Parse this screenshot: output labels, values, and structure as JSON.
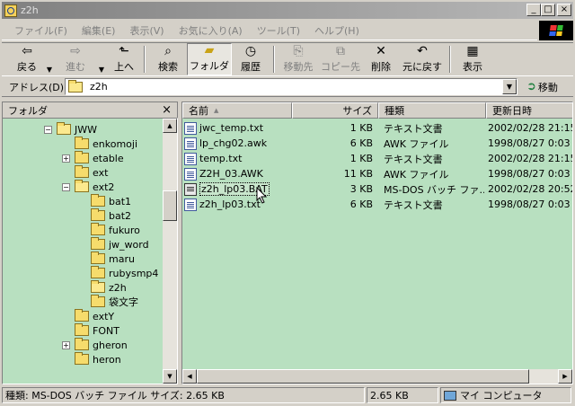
{
  "window": {
    "title": "z2h",
    "minimize": "_",
    "maximize": "□",
    "close": "×"
  },
  "menu": [
    "ファイル(F)",
    "編集(E)",
    "表示(V)",
    "お気に入り(A)",
    "ツール(T)",
    "ヘルプ(H)"
  ],
  "toolbar": {
    "back": "戻る",
    "forward": "進む",
    "up": "上へ",
    "search": "検索",
    "folders": "フォルダ",
    "history": "履歴",
    "moveto": "移動先",
    "copyto": "コピー先",
    "delete": "削除",
    "undo": "元に戻す",
    "views": "表示"
  },
  "address": {
    "label": "アドレス(D)",
    "value": "z2h",
    "go": "移動"
  },
  "folder_pane": {
    "title": "フォルダ",
    "close": "×",
    "items": [
      {
        "label": "JWW",
        "expander": "−"
      },
      {
        "label": "enkomoji",
        "expander": ""
      },
      {
        "label": "etable",
        "expander": "+"
      },
      {
        "label": "ext",
        "expander": ""
      },
      {
        "label": "ext2",
        "expander": "−"
      },
      {
        "label": "bat1",
        "expander": ""
      },
      {
        "label": "bat2",
        "expander": ""
      },
      {
        "label": "fukuro",
        "expander": ""
      },
      {
        "label": "jw_word",
        "expander": ""
      },
      {
        "label": "maru",
        "expander": ""
      },
      {
        "label": "rubysmp4",
        "expander": ""
      },
      {
        "label": "z2h",
        "expander": ""
      },
      {
        "label": "袋文字",
        "expander": ""
      },
      {
        "label": "extY",
        "expander": ""
      },
      {
        "label": "FONT",
        "expander": ""
      },
      {
        "label": "gheron",
        "expander": "+"
      },
      {
        "label": "heron",
        "expander": ""
      }
    ]
  },
  "file_list": {
    "columns": {
      "name": "名前",
      "sort_indicator": "▲",
      "size": "サイズ",
      "type": "種類",
      "modified": "更新日時"
    },
    "rows": [
      {
        "name": "jwc_temp.txt",
        "size": "1 KB",
        "type": "テキスト文書",
        "modified": "2002/02/28 21:15",
        "icon": "text-file-icon"
      },
      {
        "name": "lp_chg02.awk",
        "size": "6 KB",
        "type": "AWK ファイル",
        "modified": "1998/08/27 0:03",
        "icon": "awk-file-icon"
      },
      {
        "name": "temp.txt",
        "size": "1 KB",
        "type": "テキスト文書",
        "modified": "2002/02/28 21:15",
        "icon": "text-file-icon"
      },
      {
        "name": "Z2H_03.AWK",
        "size": "11 KB",
        "type": "AWK ファイル",
        "modified": "1998/08/27 0:03",
        "icon": "awk-file-icon"
      },
      {
        "name": "z2h_lp03.BAT",
        "size": "3 KB",
        "type": "MS-DOS バッチ ファ...",
        "modified": "2002/02/28 20:52",
        "icon": "batch-file-icon"
      },
      {
        "name": "z2h_lp03.txt",
        "size": "6 KB",
        "type": "テキスト文書",
        "modified": "1998/08/27 0:03",
        "icon": "text-file-icon"
      }
    ]
  },
  "status": {
    "info": "種類: MS-DOS バッチ ファイル サイズ: 2.65 KB",
    "size": "2.65 KB",
    "zone": "マイ コンピュータ"
  }
}
